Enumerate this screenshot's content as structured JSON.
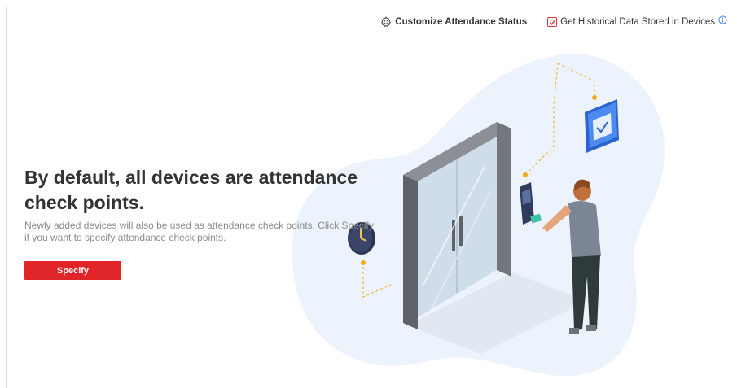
{
  "toolbar": {
    "customize_label": "Customize Attendance Status",
    "historical_label": "Get Historical Data Stored in Devices",
    "historical_checked": true
  },
  "main": {
    "headline": "By default, all devices are attendance check points.",
    "description": "Newly added devices will also be used as attendance check points. Click Specify if you want to specify attendance check points.",
    "specify_button": "Specify"
  },
  "colors": {
    "accent": "#e02529",
    "blob": "#edf3fc",
    "icon_blue": "#3b7be8"
  }
}
